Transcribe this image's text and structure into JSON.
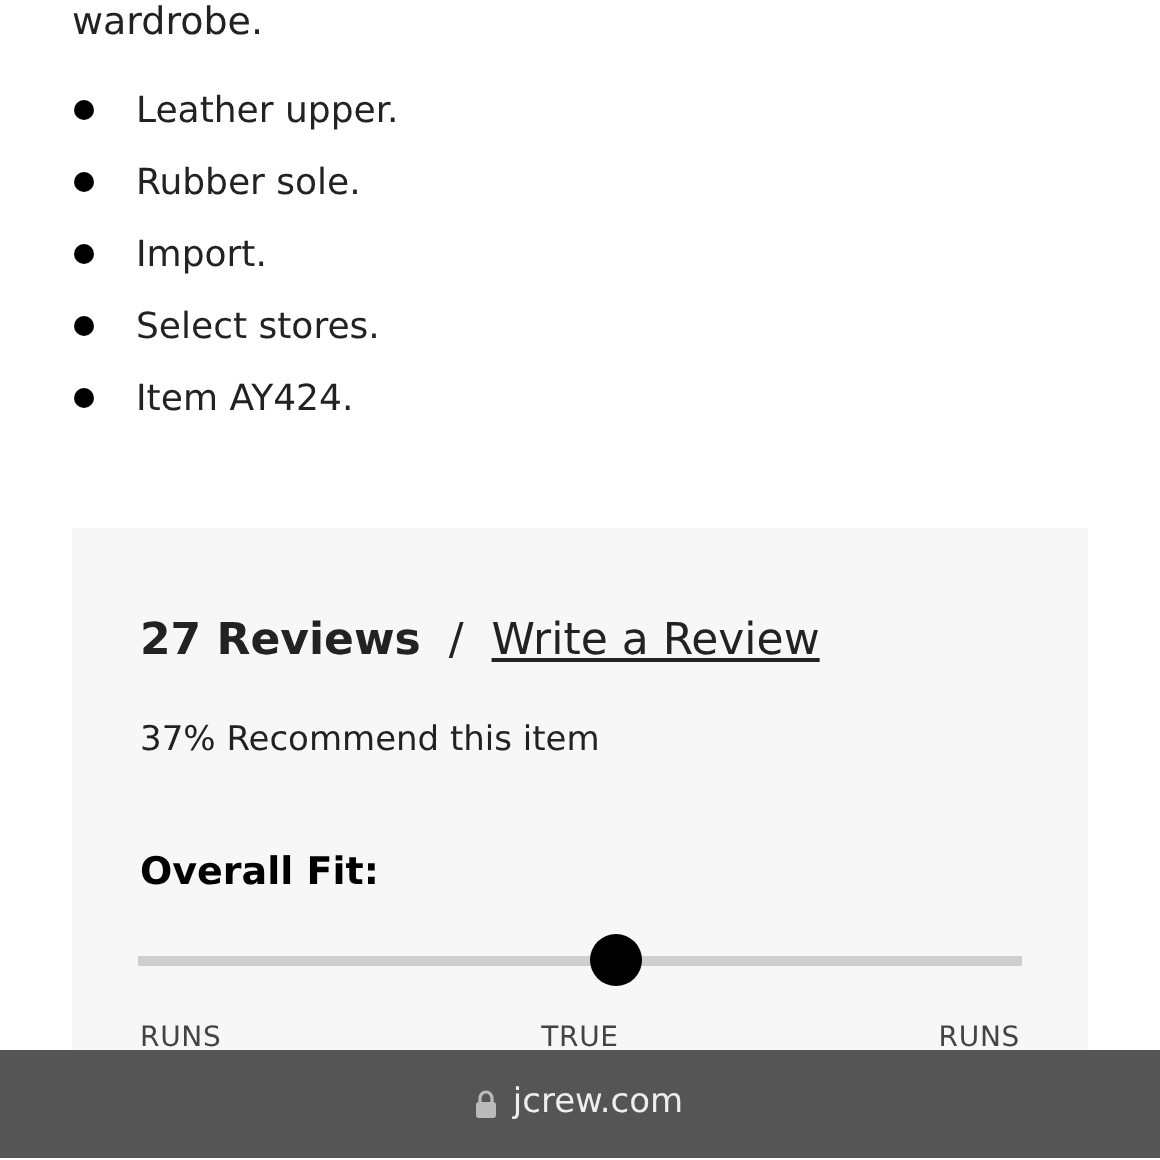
{
  "description_end": "wardrobe.",
  "features": [
    "Leather upper.",
    "Rubber sole.",
    "Import.",
    "Select stores.",
    "Item AY424."
  ],
  "reviews": {
    "count": "27 Reviews",
    "separator": "/",
    "write_link": "Write a Review",
    "recommend": "37% Recommend this item",
    "fit": {
      "label": "Overall Fit:",
      "level": 0.543,
      "labels": [
        "RUNS",
        "TRUE",
        "RUNS"
      ]
    }
  },
  "address_bar": {
    "url": "jcrew.com"
  }
}
